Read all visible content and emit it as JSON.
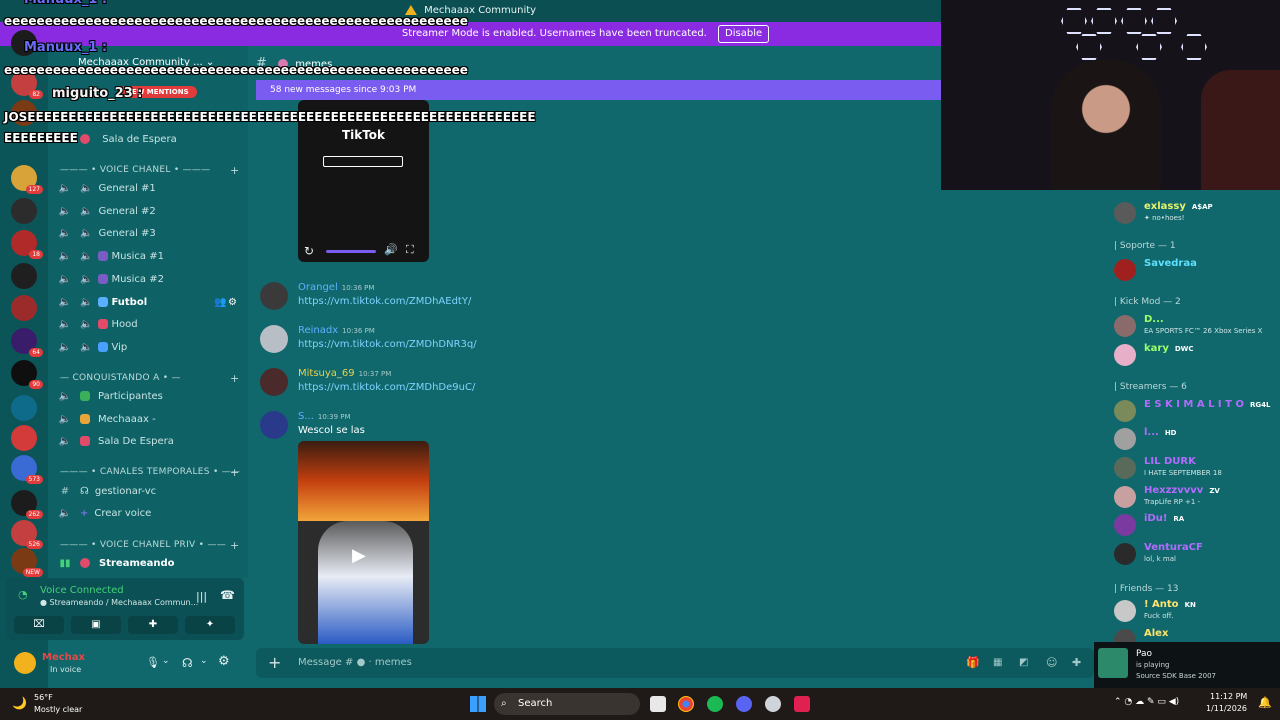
{
  "window": {
    "title": "Mechaaax Community"
  },
  "streamer_banner": {
    "text": "Streamer Mode is enabled. Usernames have been truncated.",
    "button": "Disable"
  },
  "server": {
    "name": "Mechaaax Community ..."
  },
  "mentions_badge": "NEW MENTIONS",
  "rail_badges": [
    "82",
    "127",
    "18",
    "64",
    "90",
    "573",
    "262",
    "526",
    "NEW"
  ],
  "sidebar": {
    "top_channel": "Sala de Espera",
    "categories": [
      "VOICE CHANEL",
      "CONQUISTANDO A",
      "CANALES TEMPORALES",
      "VOICE CHANEL PRIV"
    ],
    "voice_channels": [
      "General #1",
      "General #2",
      "General #3",
      "Musica #1",
      "Musica #2",
      "Futbol",
      "Hood",
      "Vip"
    ],
    "conquistando": [
      "Participantes",
      "Mechaaax -",
      "Sala De Espera"
    ],
    "temporales": [
      "gestionar-vc",
      "Crear voice"
    ],
    "priv": [
      "Streameando"
    ]
  },
  "voice": {
    "title": "Voice Connected",
    "sub": "Streameando / Mechaaax Commun..."
  },
  "user": {
    "name": "Mechax",
    "status": "In voice"
  },
  "chat": {
    "channel": "memes",
    "new_messages": "58 new messages since 9:03 PM",
    "video_label": "TikTok",
    "messages": [
      {
        "name": "Orangel",
        "time": "10:36 PM",
        "content": "https://vm.tiktok.com/ZMDhAEdtY/",
        "color": "#5db0ff"
      },
      {
        "name": "Reinadx",
        "time": "10:36 PM",
        "content": "https://vm.tiktok.com/ZMDhDNR3q/",
        "color": "#5db0ff"
      },
      {
        "name": "Mitsuya_69",
        "time": "10:37 PM",
        "content": "https://vm.tiktok.com/ZMDhDe9uC/",
        "color": "#e7d24a"
      },
      {
        "name": "S...",
        "time": "10:39 PM",
        "content": "Wescol se las",
        "color": "#5db0ff"
      }
    ],
    "composer_placeholder": "Message #",
    "composer_channel": "memes"
  },
  "members": {
    "groups": [
      {
        "label": "| Soporte — 1"
      },
      {
        "label": "| Kick Mod — 2"
      },
      {
        "label": "| Streamers — 6"
      },
      {
        "label": "| Friends — 13"
      }
    ],
    "list": [
      {
        "name": "exlassy",
        "status": "✦ no•hoes!",
        "tag": "A$AP",
        "color": "#e6f26b"
      },
      {
        "name": "Savedraa",
        "status": "",
        "tag": "",
        "color": "#5ee0ff"
      },
      {
        "name": "D...",
        "status": "EA SPORTS FC™ 26 Xbox Series X",
        "tag": "",
        "color": "#9cff6a"
      },
      {
        "name": "kary",
        "status": "",
        "tag": "DWC",
        "color": "#9cff6a"
      },
      {
        "name": "E S K I M A L I T O",
        "status": "",
        "tag": "RG4L",
        "color": "#b36bff"
      },
      {
        "name": "l...",
        "status": "",
        "tag": "HD",
        "color": "#b36bff"
      },
      {
        "name": "LIL DURK",
        "status": "I HATE SEPTEMBER 18",
        "tag": "",
        "color": "#b36bff"
      },
      {
        "name": "Hexzzvvvv",
        "status": "TrapLife RP +1 -",
        "tag": "ZV",
        "color": "#b36bff"
      },
      {
        "name": "iDu!",
        "status": "",
        "tag": "RA",
        "color": "#b36bff"
      },
      {
        "name": "VenturaCF",
        "status": "lol, k mal",
        "tag": "",
        "color": "#b36bff"
      },
      {
        "name": "! Anto",
        "status": "Fuck off.",
        "tag": "KN",
        "color": "#ffe46b"
      },
      {
        "name": "Alex",
        "status": "",
        "tag": "",
        "color": "#ffe46b"
      }
    ]
  },
  "overlay": [
    {
      "kind": "user",
      "text": "Manuux_1 :"
    },
    {
      "kind": "msg",
      "text": "eeeeeeeeeeeeeeeeeeeeeeeeeeeeeeeeeeeeeeeeeeeeeeeeeeeeeeeee"
    },
    {
      "kind": "user",
      "text": "Manuux_1 :"
    },
    {
      "kind": "msg",
      "text": "eeeeeeeeeeeeeeeeeeeeeeeeeeeeeeeeeeeeeeeeeeeeeeeeeeeeeeeee"
    },
    {
      "kind": "user",
      "text": "miguito_23 :"
    },
    {
      "kind": "msg",
      "text": "JOSEEEEEEEEEEEEEEEEEEEEEEEEEEEEEEEEEEEEEEEEEEEEEEEEEEEEEEEEEEEEEE"
    },
    {
      "kind": "msg",
      "text": "EEEEEEEEE"
    }
  ],
  "notification": {
    "name": "Pao",
    "line1": "is playing",
    "line2": "Source SDK Base 2007"
  },
  "taskbar": {
    "weather_temp": "56°F",
    "weather_desc": "Mostly clear",
    "search": "Search",
    "time": "11:12 PM",
    "date": "1/11/2026"
  },
  "colors": {
    "accent": "#8a2be2",
    "bg": "#10686c",
    "new_messages": "#7b5cf0"
  }
}
